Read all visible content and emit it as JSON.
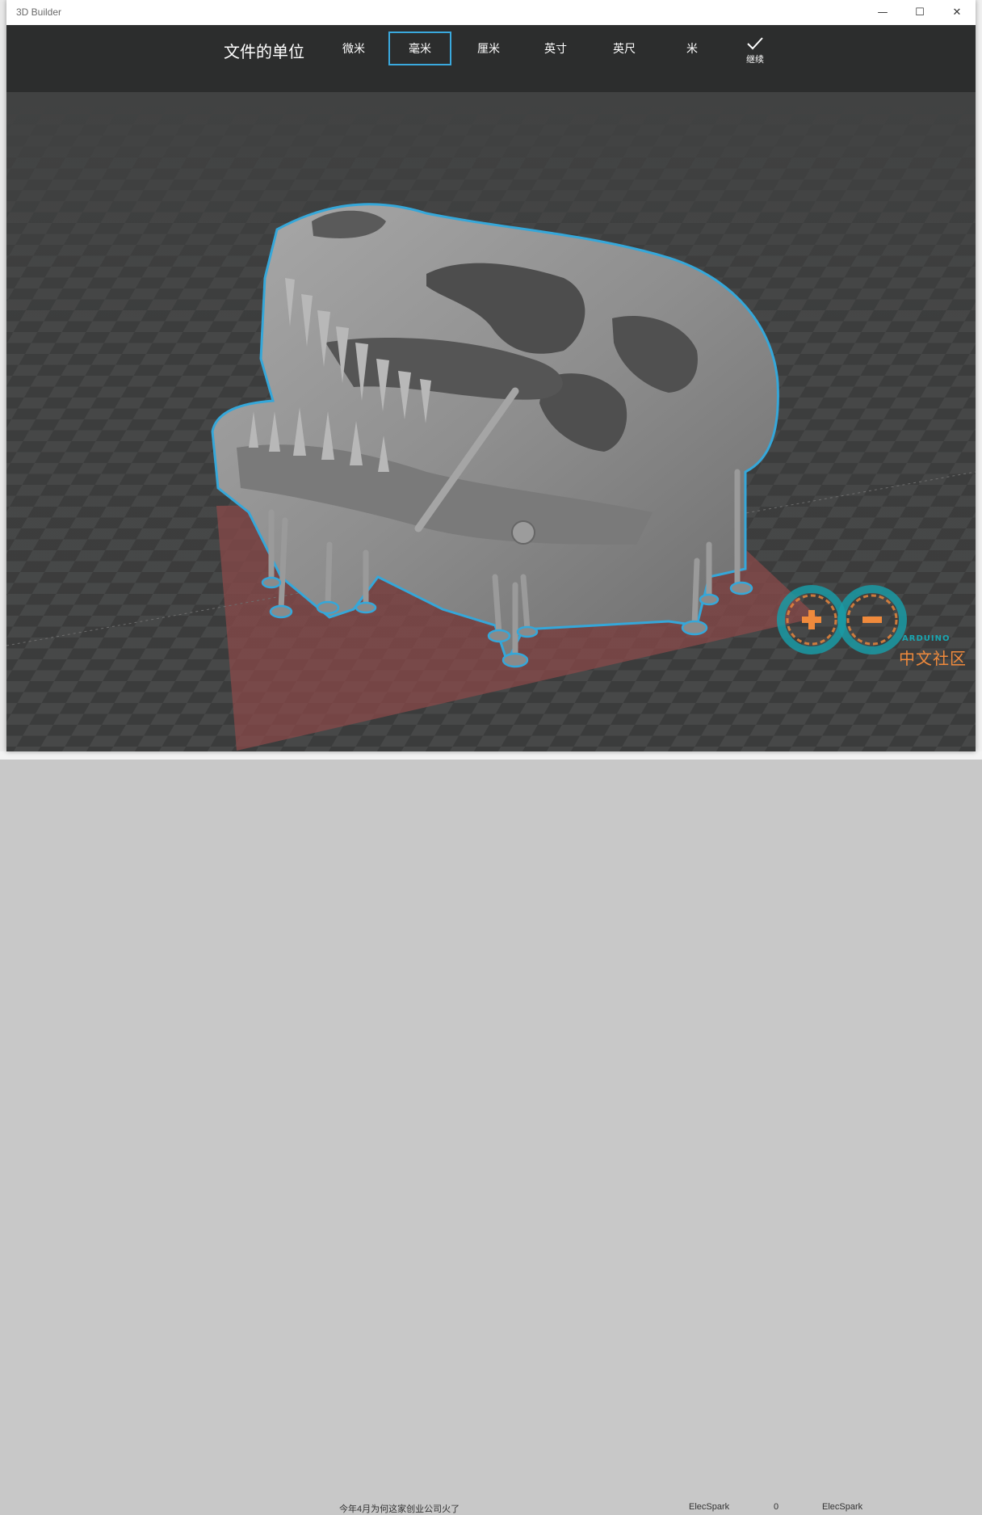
{
  "window": {
    "title": "3D Builder"
  },
  "window_controls": {
    "minimize": "—",
    "maximize": "☐",
    "close": "✕"
  },
  "toolbar": {
    "title": "文件的单位",
    "units": [
      {
        "label": "微米",
        "selected": false
      },
      {
        "label": "毫米",
        "selected": true
      },
      {
        "label": "厘米",
        "selected": false
      },
      {
        "label": "英寸",
        "selected": false
      },
      {
        "label": "英尺",
        "selected": false
      },
      {
        "label": "米",
        "selected": false
      }
    ],
    "continue_label": "继续",
    "accent_color": "#3aa9de"
  },
  "viewport": {
    "model": "dinosaur-skull-with-supports",
    "selection_outline_color": "#35a7d9",
    "build_plate_color": "#8c4a4a"
  },
  "watermark": {
    "brand_en": "ARDUINO",
    "brand_cn": "中文社区"
  },
  "background_window": {
    "row_title": "今年4月为何这家创业公司火了",
    "author": "ElecSpark",
    "count": "0",
    "last_author": "ElecSpark"
  }
}
